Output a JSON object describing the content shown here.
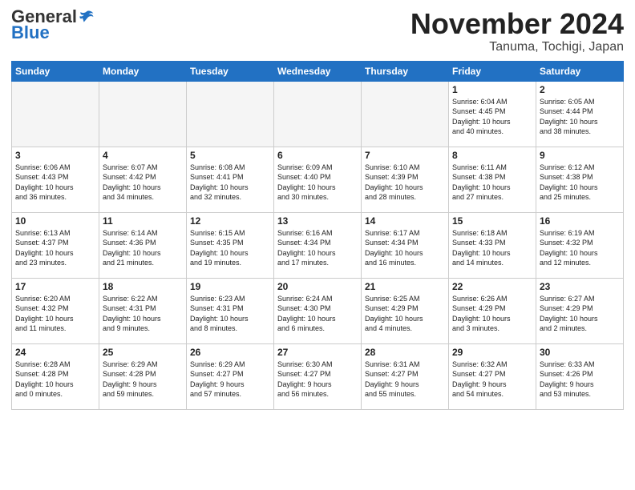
{
  "header": {
    "logo_general": "General",
    "logo_blue": "Blue",
    "month_title": "November 2024",
    "location": "Tanuma, Tochigi, Japan"
  },
  "weekdays": [
    "Sunday",
    "Monday",
    "Tuesday",
    "Wednesday",
    "Thursday",
    "Friday",
    "Saturday"
  ],
  "weeks": [
    [
      {
        "day": "",
        "info": "",
        "empty": true
      },
      {
        "day": "",
        "info": "",
        "empty": true
      },
      {
        "day": "",
        "info": "",
        "empty": true
      },
      {
        "day": "",
        "info": "",
        "empty": true
      },
      {
        "day": "",
        "info": "",
        "empty": true
      },
      {
        "day": "1",
        "info": "Sunrise: 6:04 AM\nSunset: 4:45 PM\nDaylight: 10 hours\nand 40 minutes.",
        "empty": false
      },
      {
        "day": "2",
        "info": "Sunrise: 6:05 AM\nSunset: 4:44 PM\nDaylight: 10 hours\nand 38 minutes.",
        "empty": false
      }
    ],
    [
      {
        "day": "3",
        "info": "Sunrise: 6:06 AM\nSunset: 4:43 PM\nDaylight: 10 hours\nand 36 minutes.",
        "empty": false
      },
      {
        "day": "4",
        "info": "Sunrise: 6:07 AM\nSunset: 4:42 PM\nDaylight: 10 hours\nand 34 minutes.",
        "empty": false
      },
      {
        "day": "5",
        "info": "Sunrise: 6:08 AM\nSunset: 4:41 PM\nDaylight: 10 hours\nand 32 minutes.",
        "empty": false
      },
      {
        "day": "6",
        "info": "Sunrise: 6:09 AM\nSunset: 4:40 PM\nDaylight: 10 hours\nand 30 minutes.",
        "empty": false
      },
      {
        "day": "7",
        "info": "Sunrise: 6:10 AM\nSunset: 4:39 PM\nDaylight: 10 hours\nand 28 minutes.",
        "empty": false
      },
      {
        "day": "8",
        "info": "Sunrise: 6:11 AM\nSunset: 4:38 PM\nDaylight: 10 hours\nand 27 minutes.",
        "empty": false
      },
      {
        "day": "9",
        "info": "Sunrise: 6:12 AM\nSunset: 4:38 PM\nDaylight: 10 hours\nand 25 minutes.",
        "empty": false
      }
    ],
    [
      {
        "day": "10",
        "info": "Sunrise: 6:13 AM\nSunset: 4:37 PM\nDaylight: 10 hours\nand 23 minutes.",
        "empty": false
      },
      {
        "day": "11",
        "info": "Sunrise: 6:14 AM\nSunset: 4:36 PM\nDaylight: 10 hours\nand 21 minutes.",
        "empty": false
      },
      {
        "day": "12",
        "info": "Sunrise: 6:15 AM\nSunset: 4:35 PM\nDaylight: 10 hours\nand 19 minutes.",
        "empty": false
      },
      {
        "day": "13",
        "info": "Sunrise: 6:16 AM\nSunset: 4:34 PM\nDaylight: 10 hours\nand 17 minutes.",
        "empty": false
      },
      {
        "day": "14",
        "info": "Sunrise: 6:17 AM\nSunset: 4:34 PM\nDaylight: 10 hours\nand 16 minutes.",
        "empty": false
      },
      {
        "day": "15",
        "info": "Sunrise: 6:18 AM\nSunset: 4:33 PM\nDaylight: 10 hours\nand 14 minutes.",
        "empty": false
      },
      {
        "day": "16",
        "info": "Sunrise: 6:19 AM\nSunset: 4:32 PM\nDaylight: 10 hours\nand 12 minutes.",
        "empty": false
      }
    ],
    [
      {
        "day": "17",
        "info": "Sunrise: 6:20 AM\nSunset: 4:32 PM\nDaylight: 10 hours\nand 11 minutes.",
        "empty": false
      },
      {
        "day": "18",
        "info": "Sunrise: 6:22 AM\nSunset: 4:31 PM\nDaylight: 10 hours\nand 9 minutes.",
        "empty": false
      },
      {
        "day": "19",
        "info": "Sunrise: 6:23 AM\nSunset: 4:31 PM\nDaylight: 10 hours\nand 8 minutes.",
        "empty": false
      },
      {
        "day": "20",
        "info": "Sunrise: 6:24 AM\nSunset: 4:30 PM\nDaylight: 10 hours\nand 6 minutes.",
        "empty": false
      },
      {
        "day": "21",
        "info": "Sunrise: 6:25 AM\nSunset: 4:29 PM\nDaylight: 10 hours\nand 4 minutes.",
        "empty": false
      },
      {
        "day": "22",
        "info": "Sunrise: 6:26 AM\nSunset: 4:29 PM\nDaylight: 10 hours\nand 3 minutes.",
        "empty": false
      },
      {
        "day": "23",
        "info": "Sunrise: 6:27 AM\nSunset: 4:29 PM\nDaylight: 10 hours\nand 2 minutes.",
        "empty": false
      }
    ],
    [
      {
        "day": "24",
        "info": "Sunrise: 6:28 AM\nSunset: 4:28 PM\nDaylight: 10 hours\nand 0 minutes.",
        "empty": false
      },
      {
        "day": "25",
        "info": "Sunrise: 6:29 AM\nSunset: 4:28 PM\nDaylight: 9 hours\nand 59 minutes.",
        "empty": false
      },
      {
        "day": "26",
        "info": "Sunrise: 6:29 AM\nSunset: 4:27 PM\nDaylight: 9 hours\nand 57 minutes.",
        "empty": false
      },
      {
        "day": "27",
        "info": "Sunrise: 6:30 AM\nSunset: 4:27 PM\nDaylight: 9 hours\nand 56 minutes.",
        "empty": false
      },
      {
        "day": "28",
        "info": "Sunrise: 6:31 AM\nSunset: 4:27 PM\nDaylight: 9 hours\nand 55 minutes.",
        "empty": false
      },
      {
        "day": "29",
        "info": "Sunrise: 6:32 AM\nSunset: 4:27 PM\nDaylight: 9 hours\nand 54 minutes.",
        "empty": false
      },
      {
        "day": "30",
        "info": "Sunrise: 6:33 AM\nSunset: 4:26 PM\nDaylight: 9 hours\nand 53 minutes.",
        "empty": false
      }
    ]
  ]
}
